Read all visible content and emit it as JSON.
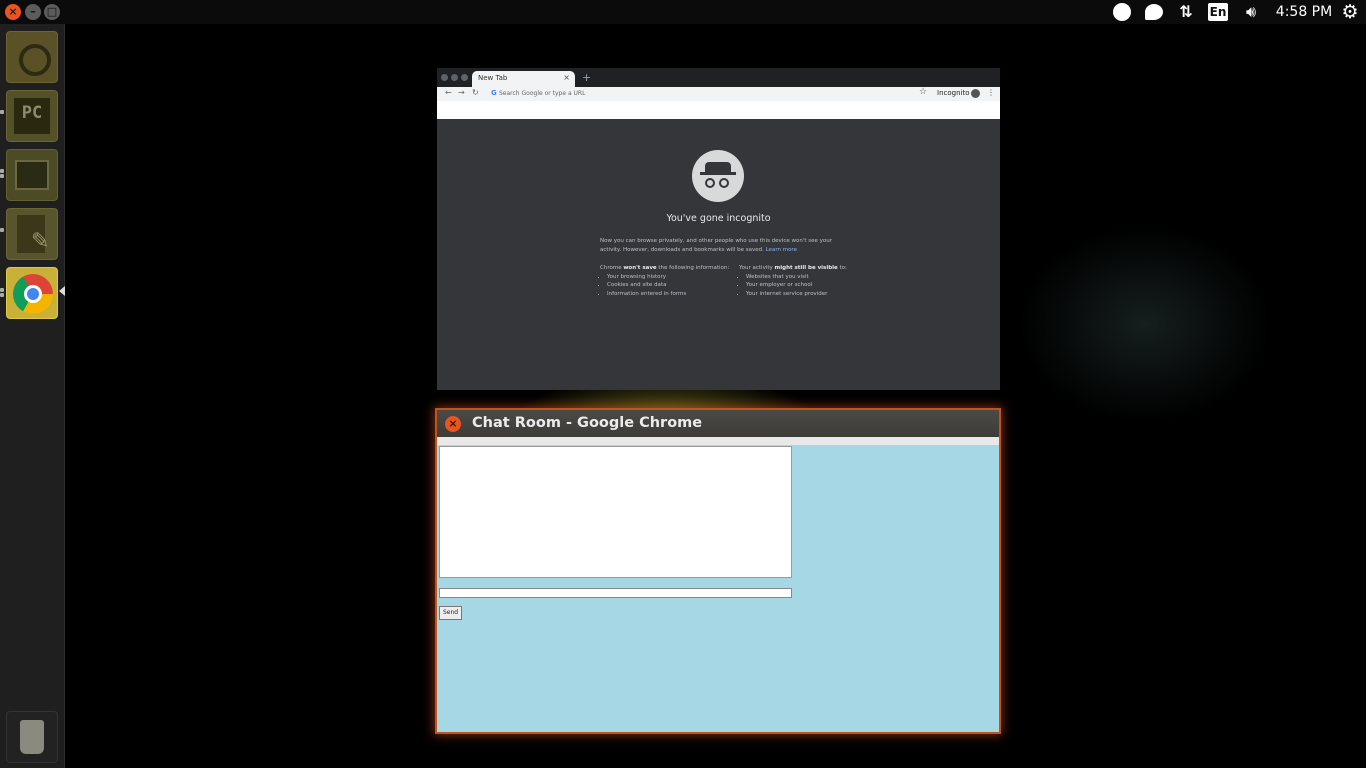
{
  "top_panel": {
    "clock": "4:58 PM",
    "language": "En",
    "indicators": [
      "circle-indicator-icon",
      "chat-bubble-indicator-icon",
      "network-arrows-icon",
      "volume-icon",
      "system-gear-icon"
    ]
  },
  "launcher": {
    "items": [
      {
        "name": "dash-home",
        "icon": "ubuntu-logo-icon"
      },
      {
        "name": "pycharm",
        "icon": "pycharm-icon",
        "text": "PC"
      },
      {
        "name": "files",
        "icon": "file-cabinet-icon"
      },
      {
        "name": "text-editor",
        "icon": "text-editor-icon"
      },
      {
        "name": "chrome",
        "icon": "chrome-icon",
        "active": true
      },
      {
        "name": "trash",
        "icon": "trash-icon"
      }
    ]
  },
  "incognito_window": {
    "tab_title": "New Tab",
    "tab_close": "×",
    "new_tab": "+",
    "omnibox_g": "G",
    "omnibox_placeholder": "Search Google or type a URL",
    "profile_label": "Incognito",
    "heading": "You've gone incognito",
    "intro": "Now you can browse privately, and other people who use this device won't see your activity. However, downloads and bookmarks will be saved.",
    "learn_more": "Learn more",
    "left_heading_pre": "Chrome ",
    "left_heading_bold": "won't save",
    "left_heading_post": " the following information:",
    "left_items": [
      "Your browsing history",
      "Cookies and site data",
      "Information entered in forms"
    ],
    "right_heading_pre": "Your activity ",
    "right_heading_bold": "might still be visible",
    "right_heading_post": " to:",
    "right_items": [
      "Websites that you visit",
      "Your employer or school",
      "Your internet service provider"
    ]
  },
  "chat_window": {
    "title": "Chat Room - Google Chrome",
    "close": "×",
    "send_label": "Send",
    "background": "#a6d7e5"
  },
  "colors": {
    "accent": "#e95420",
    "incognito_bg": "#35363a",
    "chat_bg": "#a6d7e5"
  }
}
